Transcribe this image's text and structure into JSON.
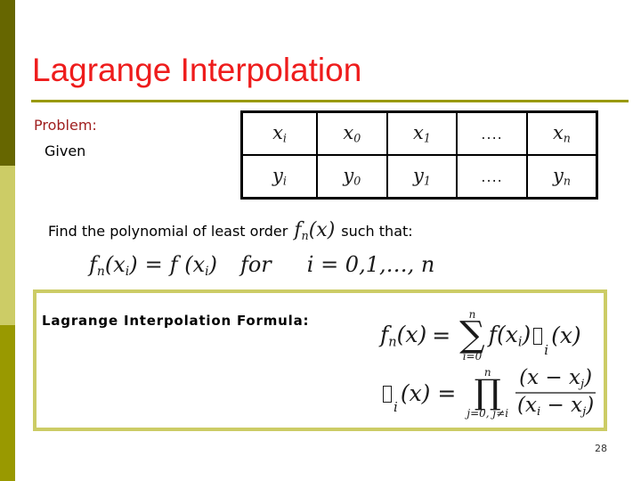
{
  "slide": {
    "title": "Lagrange Interpolation",
    "page_number": "28",
    "problem_label": "Problem:",
    "given_text": "Given"
  },
  "colors": {
    "title_red": "#EE1C1C",
    "problem_red": "#A02020",
    "rule_olive": "#999900",
    "bar_dark_olive": "#666600",
    "bar_khaki": "#CCCC66",
    "bar_olive": "#999900",
    "box_border": "#CCCC66",
    "table_border": "#000000"
  },
  "left_bar": {
    "segments": [
      {
        "name": "top",
        "color": "#666600"
      },
      {
        "name": "middle",
        "color": "#CCCC66"
      },
      {
        "name": "bottom",
        "color": "#999900"
      }
    ]
  },
  "table": {
    "rows": [
      {
        "label": "x",
        "cells": [
          {
            "base": "x",
            "sub": "i",
            "type": "math"
          },
          {
            "base": "x",
            "sub": "0",
            "type": "math"
          },
          {
            "base": "x",
            "sub": "1",
            "type": "math"
          },
          {
            "base": "....",
            "sub": "",
            "type": "dots"
          },
          {
            "base": "x",
            "sub": "n",
            "type": "math"
          }
        ]
      },
      {
        "label": "y",
        "cells": [
          {
            "base": "y",
            "sub": "i",
            "type": "math"
          },
          {
            "base": "y",
            "sub": "0",
            "type": "math"
          },
          {
            "base": "y",
            "sub": "1",
            "type": "math"
          },
          {
            "base": "....",
            "sub": "",
            "type": "dots"
          },
          {
            "base": "y",
            "sub": "n",
            "type": "math"
          }
        ]
      }
    ]
  },
  "find_line": {
    "prefix": "Find the polynomial of least order",
    "fn_base": "f",
    "fn_sub": "n",
    "fn_arg": "(x)",
    "suffix": "such that:"
  },
  "condition_line": {
    "lhs_f": "f",
    "lhs_sub": "n",
    "lhs_arg": "(x",
    "lhs_arg_sub": "i",
    "lhs_arg_close": ")",
    "equals": "=",
    "rhs": "f (x",
    "rhs_sub": "i",
    "rhs_close": ")",
    "for_word": "for",
    "index_text": "i = 0,1,…, n"
  },
  "formula_box": {
    "label": "Lagrange Interpolation Formula:",
    "sum_formula": {
      "lhs_f": "f",
      "lhs_sub": "n",
      "lhs_arg": "(x)",
      "equals": "=",
      "op_glyph": "∑",
      "op_upper": "n",
      "op_lower": "i=0",
      "term_f": "f",
      "term_arg_open": "(x",
      "term_arg_sub": "i",
      "term_arg_close": ")",
      "lambda_glyph": "tofu-box",
      "lambda_sub": "i",
      "lambda_arg": "(x)"
    },
    "prod_formula": {
      "lhs_glyph": "tofu-box",
      "lhs_sub": "i",
      "lhs_arg": "(x)",
      "equals": "=",
      "op_glyph": "∏",
      "op_upper": "n",
      "op_lower": "j=0, j≠i",
      "numerator": "(x − x",
      "numerator_sub": "j",
      "numerator_close": ")",
      "denominator_open": "(x",
      "denominator_sub1": "i",
      "denominator_mid": " − x",
      "denominator_sub2": "j",
      "denominator_close": ")"
    }
  }
}
